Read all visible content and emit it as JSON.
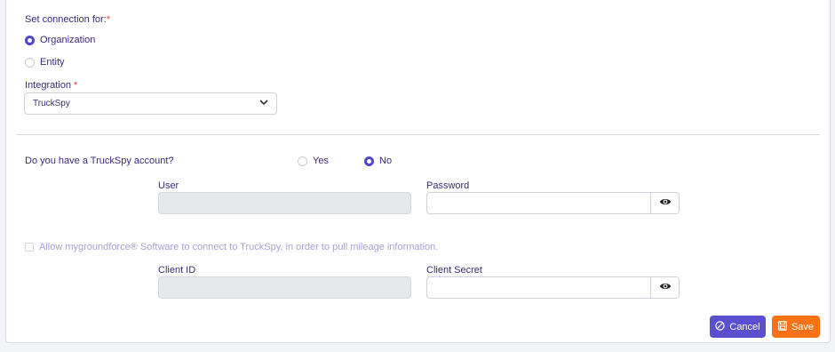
{
  "connection": {
    "label": "Set connection for:",
    "required_mark": "*",
    "options": [
      {
        "label": "Organization",
        "selected": true
      },
      {
        "label": "Entity",
        "selected": false
      }
    ]
  },
  "integration": {
    "label": "Integration",
    "required_mark": "*",
    "selected_value": "TruckSpy"
  },
  "account_question": {
    "label": "Do you have a TruckSpy account?",
    "options": [
      {
        "label": "Yes",
        "selected": false
      },
      {
        "label": "No",
        "selected": true
      }
    ]
  },
  "credentials": {
    "user_label": "User",
    "user_value": "",
    "password_label": "Password",
    "password_value": ""
  },
  "consent": {
    "label": "Allow mygroundforce® Software to connect to TruckSpy, in order to pull mileage information.",
    "checked": false
  },
  "client": {
    "client_id_label": "Client ID",
    "client_id_value": "",
    "client_secret_label": "Client Secret",
    "client_secret_value": ""
  },
  "actions": {
    "cancel_label": "Cancel",
    "save_label": "Save"
  },
  "colors": {
    "accent": "#5a4fcf",
    "save": "#f97316",
    "text": "#3b2a7a",
    "required": "#e53e3e"
  },
  "icons": {
    "eye": "eye-icon",
    "cancel": "cancel-circle-icon",
    "save": "save-icon",
    "dropdown": "chevron-down-icon"
  }
}
